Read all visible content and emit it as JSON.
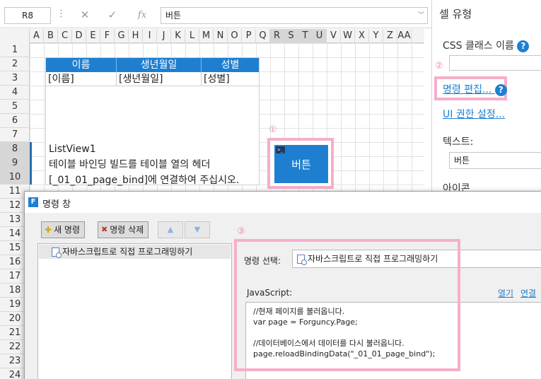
{
  "formula_bar": {
    "name_box": "R8",
    "dots": "⋮",
    "cancel_icon": "✕",
    "confirm_icon": "✓",
    "fx_icon": "fx",
    "value": "버튼",
    "dropdown": "﹀"
  },
  "sheet": {
    "columns": [
      "A",
      "B",
      "C",
      "D",
      "E",
      "F",
      "G",
      "H",
      "I",
      "J",
      "K",
      "L",
      "M",
      "N",
      "O",
      "P",
      "Q",
      "R",
      "S",
      "T",
      "U",
      "V",
      "W",
      "X",
      "Y",
      "Z",
      "AA"
    ],
    "selected_columns": [
      "R",
      "S",
      "T",
      "U"
    ],
    "rows": [
      "1",
      "2",
      "3",
      "4",
      "5",
      "6",
      "7",
      "8",
      "9",
      "10",
      "11",
      "12",
      "13",
      "14",
      "15",
      "16",
      "17",
      "18",
      "19",
      "20",
      "21",
      "22",
      "23",
      "24"
    ],
    "selected_rows": [
      "8",
      "9",
      "10"
    ],
    "listview": {
      "headers": [
        "이름",
        "생년월일",
        "성별"
      ],
      "row": [
        "[이름]",
        "[생년월일]",
        "[성별]"
      ],
      "name": "ListView1",
      "line1": "테이블 바인딩 빌드를 테이블 열의 헤더",
      "line2": "[_01_01_page_bind]에 연결하여 주십시오."
    },
    "marker_1": "①",
    "button_text": "버튼",
    "button_tag": ">_"
  },
  "right_panel": {
    "title": "셀 유형",
    "css_label": "CSS 클래스 이름",
    "help": "?",
    "marker_2": "②",
    "edit_command": "명령 편집...",
    "ui_permission": "UI 권한 설정...",
    "text_label": "텍스트:",
    "text_value": "버튼",
    "icon_label": "아이콘"
  },
  "command_window": {
    "logo": "F",
    "title": "명령 창",
    "new_command": "새 명령",
    "delete_command": "명령 삭제",
    "up_icon": "▲",
    "down_icon": "▼",
    "list_item": "자바스크립트로 직접 프로그래밍하기",
    "marker_3": "③",
    "select_label": "명령 선택:",
    "select_value": "자바스크립트로 직접 프로그래밍하기",
    "js_label": "JavaScript:",
    "open_link": "열기",
    "connect_link": "연결",
    "code_lines": [
      "//현재 페이지를 불러옵니다.",
      "var page = Forguncy.Page;",
      "",
      "//데이터베이스에서 데이터를 다시 불러옵니다.",
      "page.reloadBindingData(\"_01_01_page_bind\");"
    ]
  },
  "colors": {
    "accent": "#1e7fd1",
    "highlight_frame": "#f6aecb",
    "marker": "#f08cb4"
  }
}
